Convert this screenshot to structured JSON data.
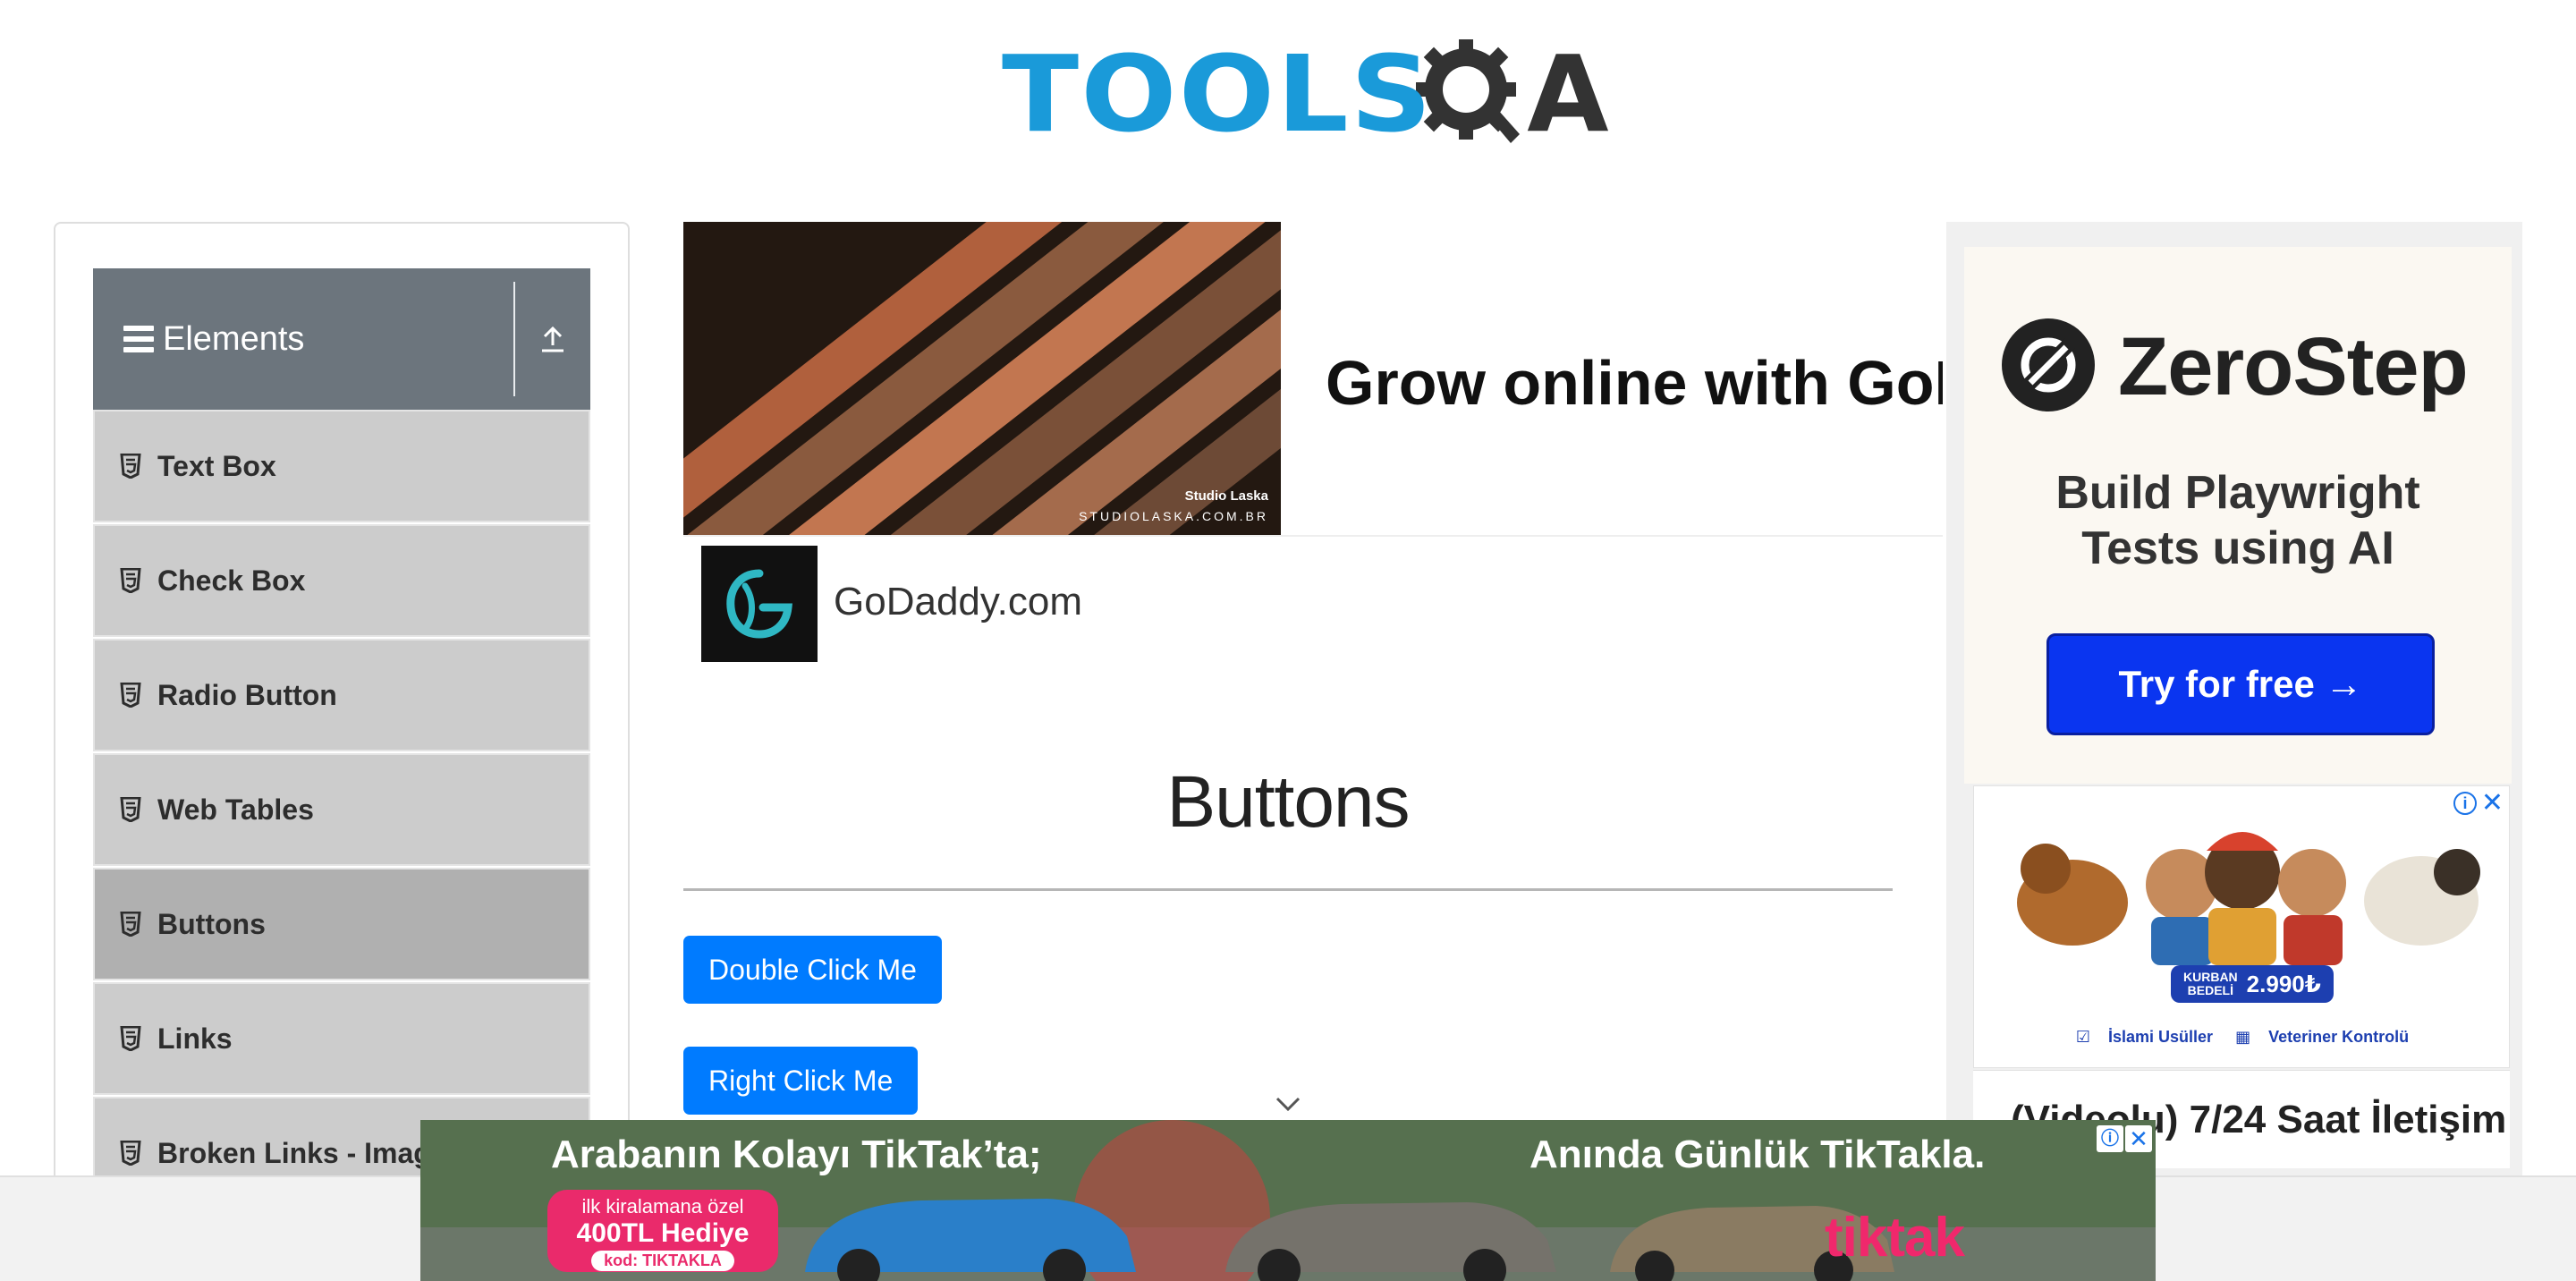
{
  "logo": {
    "text": "TOOLS",
    "text_end": "A",
    "primary_color": "#1a9ad9",
    "dark_color": "#333333"
  },
  "sidebar": {
    "group_title": "Elements",
    "items": [
      {
        "label": "Text Box",
        "active": false
      },
      {
        "label": "Check Box",
        "active": false
      },
      {
        "label": "Radio Button",
        "active": false
      },
      {
        "label": "Web Tables",
        "active": false
      },
      {
        "label": "Buttons",
        "active": true
      },
      {
        "label": "Links",
        "active": false
      },
      {
        "label": "Broken Links - Images",
        "active": false
      }
    ]
  },
  "top_ad": {
    "photo_credit_name": "Studio Laska",
    "photo_credit_url": "STUDIOLASKA.COM.BR",
    "headline": "Grow online with GoDaddy",
    "advertiser": "GoDaddy.com"
  },
  "main": {
    "title": "Buttons",
    "double_click_label": "Double Click Me",
    "right_click_label": "Right Click Me",
    "primary_color": "#007bff"
  },
  "zerostep_ad": {
    "brand": "ZeroStep",
    "tagline_line1": "Build Playwright",
    "tagline_line2": "Tests using AI",
    "cta": "Try for free →",
    "cta_color": "#0a35f0"
  },
  "kurban_ad": {
    "price_label_line1": "KURBAN",
    "price_label_line2": "BEDELİ",
    "price": "2.990₺",
    "feature1": "İslami Usüller",
    "feature2": "Veteriner Kontrolü",
    "video_text": "(Videolu) 7/24 Saat İletişim"
  },
  "sticky_ad": {
    "headline_left": "Arabanın Kolayı TikTak’ta;",
    "headline_right": "Anında Günlük TikTakla.",
    "promo_line1": "ilk kiralamana özel",
    "promo_line2": "400TL Hediye",
    "promo_code": "kod: TIKTAKLA",
    "brand": "tiktak",
    "brand_color": "#f0286c"
  }
}
